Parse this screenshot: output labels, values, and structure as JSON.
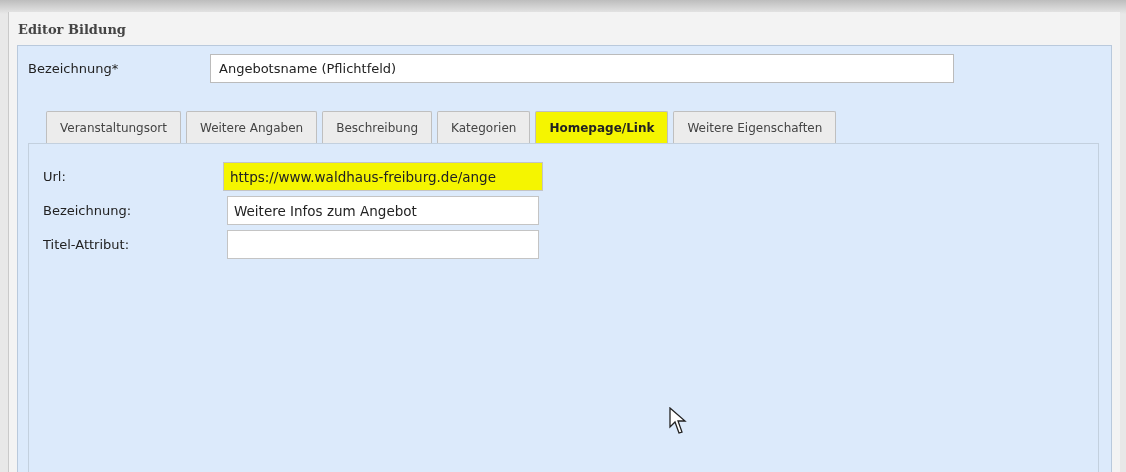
{
  "window": {
    "title": "Editor Bildung"
  },
  "name_field": {
    "label": "Bezeichnung*",
    "value": "Angebotsname (Pflichtfeld)"
  },
  "tabs": [
    {
      "label": "Veranstaltungsort",
      "selected": false,
      "highlighted": false
    },
    {
      "label": "Weitere Angaben",
      "selected": false,
      "highlighted": false
    },
    {
      "label": "Beschreibung",
      "selected": false,
      "highlighted": false
    },
    {
      "label": "Kategorien",
      "selected": false,
      "highlighted": false
    },
    {
      "label": "Homepage/Link",
      "selected": true,
      "highlighted": true
    },
    {
      "label": "Weitere Eigenschaften",
      "selected": false,
      "highlighted": false
    }
  ],
  "fields": [
    {
      "label": "Url:",
      "value": "https://www.waldhaus-freiburg.de/ange",
      "highlighted": true
    },
    {
      "label": "Bezeichnung:",
      "value": "Weitere Infos zum Angebot",
      "highlighted": false
    },
    {
      "label": "Titel-Attribut:",
      "highlighted": false
    }
  ]
}
